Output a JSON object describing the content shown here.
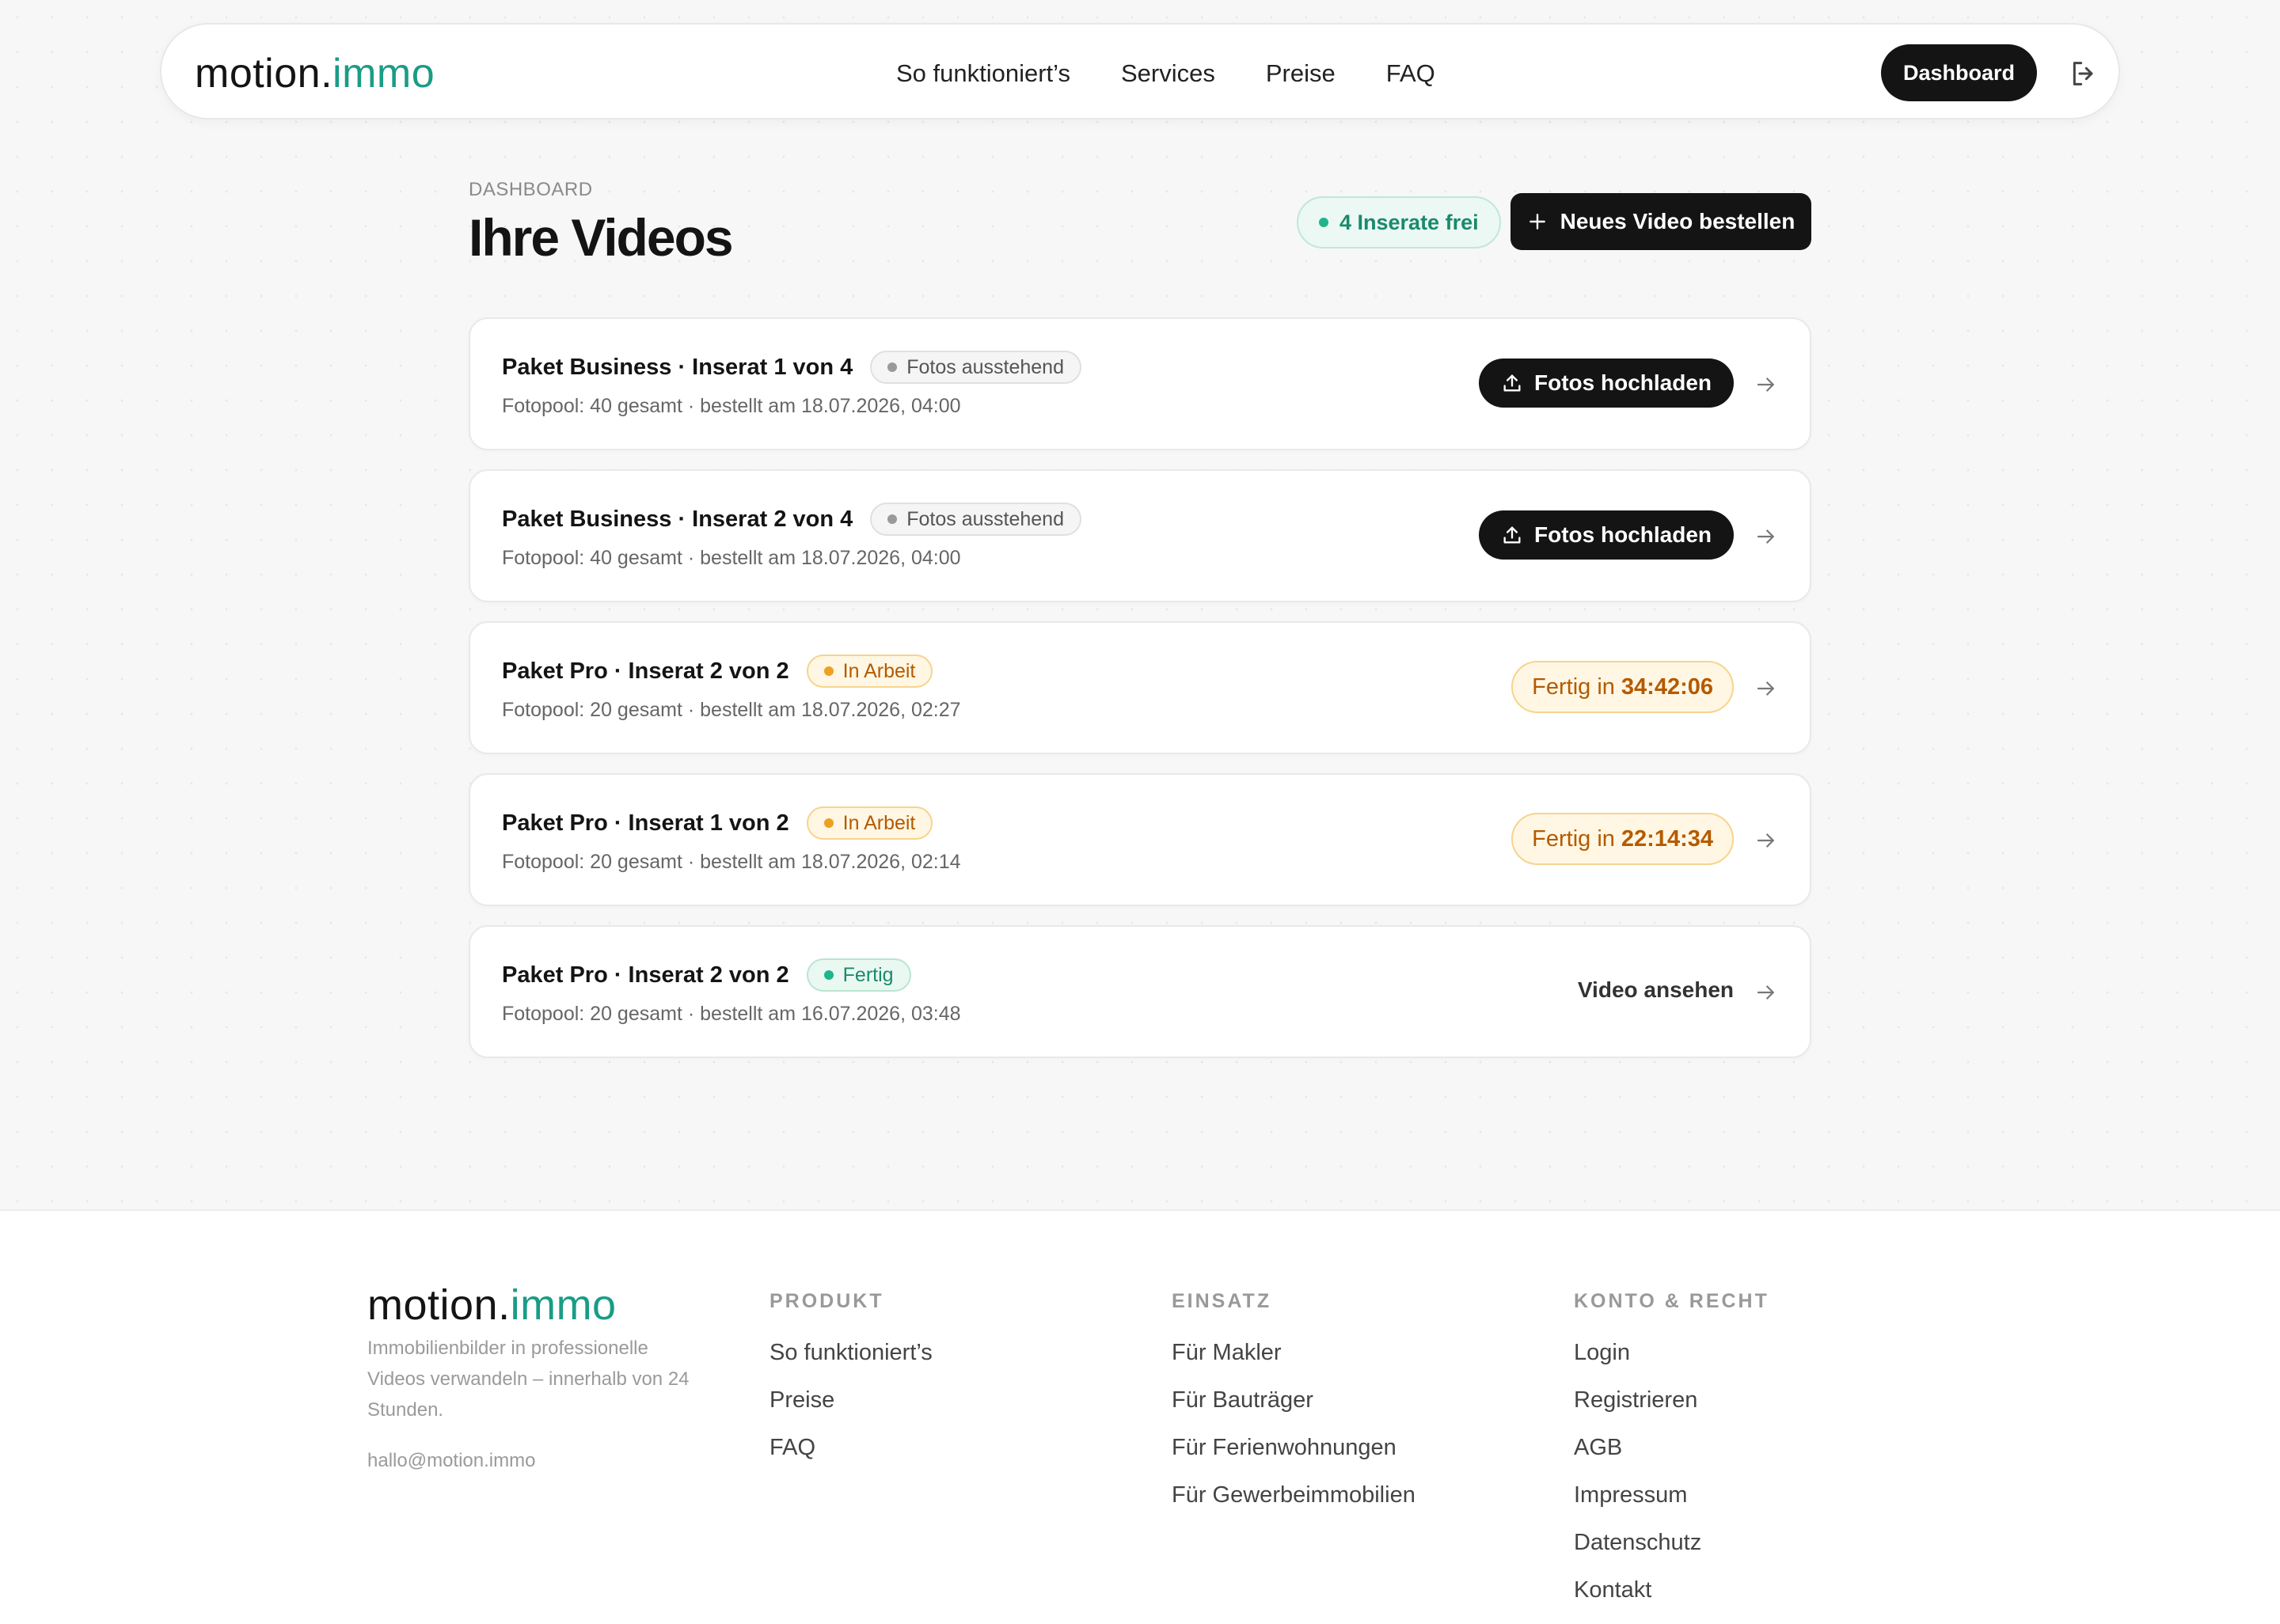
{
  "nav": {
    "logo_main": "motion.",
    "logo_accent": "immo",
    "links": [
      "So funktioniert’s",
      "Services",
      "Preise",
      "FAQ"
    ],
    "dashboard_label": "Dashboard",
    "logout_icon": "logout-icon"
  },
  "header": {
    "kicker": "DASHBOARD",
    "title": "Ihre Videos",
    "free_badge": "4 Inserate frei",
    "order_button": "Neues Video bestellen"
  },
  "videos": [
    {
      "title": "Paket Business · Inserat 1 von 4",
      "status": "Fotos ausstehend",
      "meta": "Fotopool: 40 gesamt · bestellt am 18.07.2026, 04:00",
      "action": "Fotos hochladen"
    },
    {
      "title": "Paket Business · Inserat 2 von 4",
      "status": "Fotos ausstehend",
      "meta": "Fotopool: 40 gesamt · bestellt am 18.07.2026, 04:00",
      "action": "Fotos hochladen"
    },
    {
      "title": "Paket Pro · Inserat 2 von 2",
      "status": "In Arbeit",
      "meta": "Fotopool: 20 gesamt · bestellt am 18.07.2026, 02:27",
      "timer_label": "Fertig in",
      "timer": "34:42:06"
    },
    {
      "title": "Paket Pro · Inserat 1 von 2",
      "status": "In Arbeit",
      "meta": "Fotopool: 20 gesamt · bestellt am 18.07.2026, 02:14",
      "timer_label": "Fertig in",
      "timer": "22:14:34"
    },
    {
      "title": "Paket Pro · Inserat 2 von 2",
      "status": "Fertig",
      "meta": "Fotopool: 20 gesamt · bestellt am 16.07.2026, 03:48",
      "action": "Video ansehen"
    }
  ],
  "footer": {
    "logo_main": "motion.",
    "logo_accent": "immo",
    "description": "Immobilienbilder in professionelle Videos verwandeln – innerhalb von 24 Stunden.",
    "email": "hallo@motion.immo",
    "columns": [
      {
        "heading": "PRODUKT",
        "links": [
          "So funktioniert’s",
          "Preise",
          "FAQ"
        ]
      },
      {
        "heading": "EINSATZ",
        "links": [
          "Für Makler",
          "Für Bauträger",
          "Für Ferienwohnungen",
          "Für Gewerbeimmobilien"
        ]
      },
      {
        "heading": "KONTO & RECHT",
        "links": [
          "Login",
          "Registrieren",
          "AGB",
          "Impressum",
          "Datenschutz",
          "Kontakt"
        ]
      }
    ]
  },
  "colors": {
    "accent": "#1a9c86",
    "dark": "#141414",
    "status_pending": "#9a9a9a",
    "status_in_progress": "#f0a020",
    "status_done": "#1fb58a"
  }
}
